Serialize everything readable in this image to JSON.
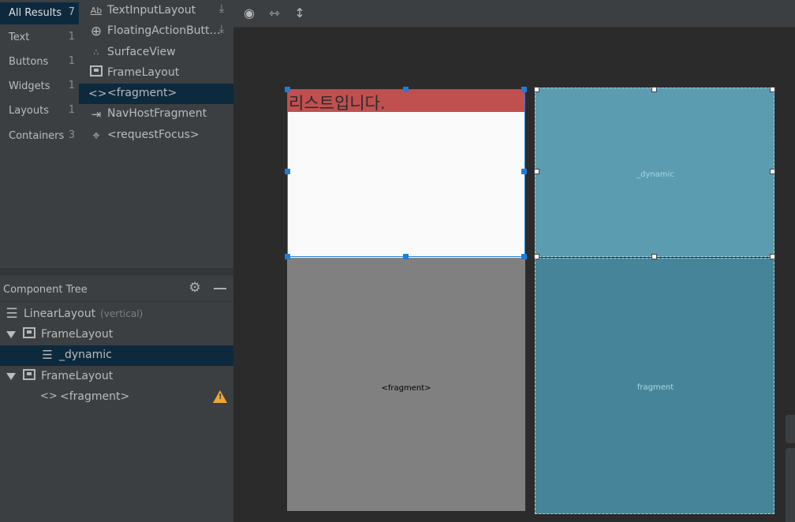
{
  "palette": {
    "categories": [
      {
        "label": "All Results",
        "count": "7",
        "selected": true
      },
      {
        "label": "Text",
        "count": "1"
      },
      {
        "label": "Buttons",
        "count": "1"
      },
      {
        "label": "Widgets",
        "count": "1"
      },
      {
        "label": "Layouts",
        "count": "1"
      },
      {
        "label": "Containers",
        "count": "3"
      }
    ],
    "items": [
      {
        "label": "TextInputLayout",
        "icon": "text-field-icon",
        "download": true
      },
      {
        "label": "FloatingActionButt…",
        "icon": "add-circle-icon",
        "download": true
      },
      {
        "label": "SurfaceView",
        "icon": "surface-view-icon"
      },
      {
        "label": "FrameLayout",
        "icon": "frame-layout-icon"
      },
      {
        "label": "<fragment>",
        "icon": "code-brackets-icon",
        "selected": true
      },
      {
        "label": "NavHostFragment",
        "icon": "nav-host-icon"
      },
      {
        "label": "<requestFocus>",
        "icon": "focus-icon"
      }
    ]
  },
  "component_tree": {
    "title": "Component Tree",
    "nodes": [
      {
        "label": "LinearLayout",
        "sub": "(vertical)",
        "icon": "linear-layout-icon"
      },
      {
        "label": "FrameLayout",
        "icon": "frame-layout-icon",
        "expanded": true
      },
      {
        "label": "_dynamic",
        "icon": "list-icon",
        "selected": true
      },
      {
        "label": "FrameLayout",
        "icon": "frame-layout-icon",
        "expanded": true
      },
      {
        "label": "<fragment>",
        "icon": "code-brackets-icon",
        "warning": true
      }
    ]
  },
  "design": {
    "list_text": "리스트입니다.",
    "fragment_label": "<fragment>"
  },
  "blueprint": {
    "top_label": "_dynamic",
    "bottom_label": "fragment"
  },
  "colors": {
    "selection": "#0d293e",
    "panel": "#3c3f41",
    "canvas": "#2b2b2b",
    "red_band": "#c05050",
    "blueprint_top": "#5b9cb0",
    "blueprint_bottom": "#468599",
    "handle": "#1f7cd8",
    "warning": "#f0a732"
  }
}
